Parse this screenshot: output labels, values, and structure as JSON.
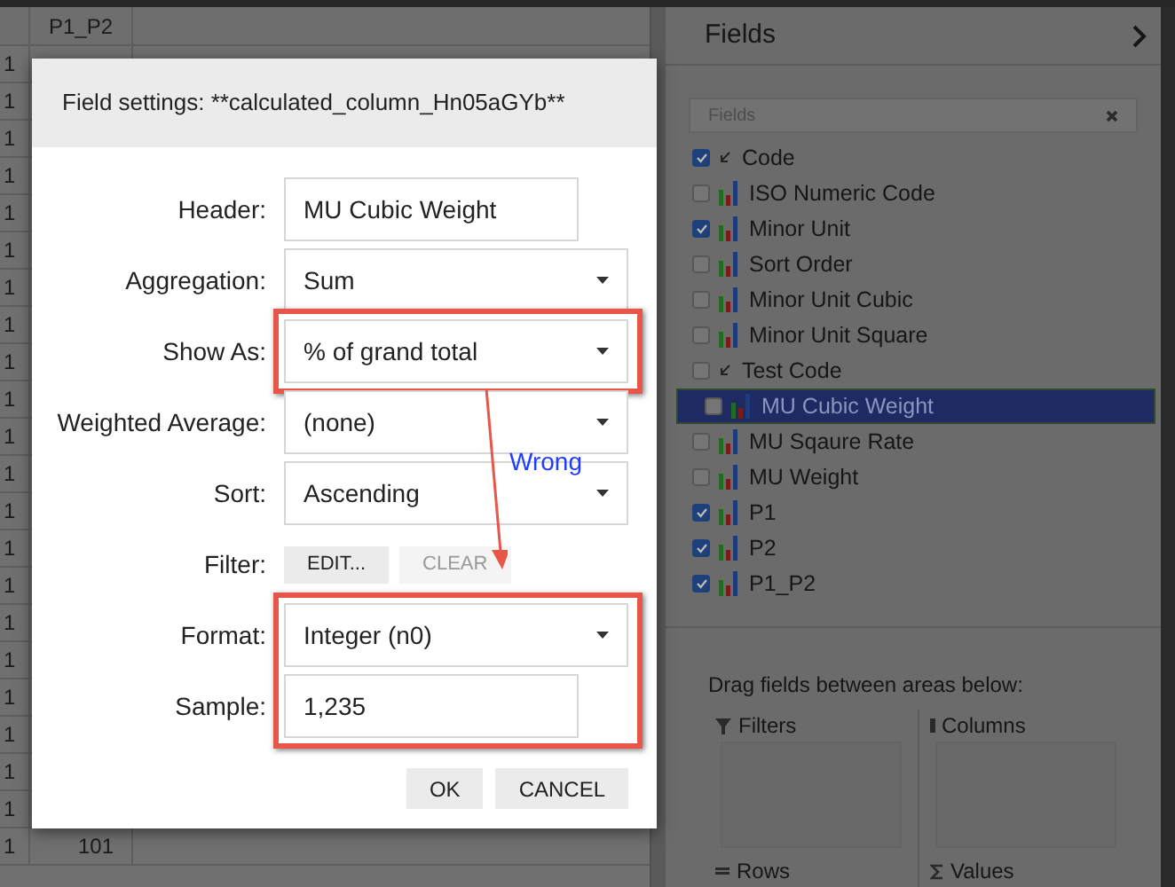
{
  "grid": {
    "header": "P1_P2",
    "rows": [
      {
        "column_1": "1"
      },
      {
        "column_1": "1"
      },
      {
        "column_1": "1"
      },
      {
        "column_1": "1"
      },
      {
        "column_1": "1"
      },
      {
        "column_1": "1"
      },
      {
        "column_1": "1"
      },
      {
        "column_1": "1"
      },
      {
        "column_1": "1"
      },
      {
        "column_1": "1"
      },
      {
        "column_1": "1"
      },
      {
        "column_1": "1"
      },
      {
        "column_1": "1"
      },
      {
        "column_1": "1"
      },
      {
        "column_1": "1"
      },
      {
        "column_1": "1"
      },
      {
        "column_1": "1"
      },
      {
        "column_1": "1"
      },
      {
        "column_1": "1"
      },
      {
        "column_1": "1"
      },
      {
        "column_1": "1"
      },
      {
        "column_1": "1",
        "p1_p2": "101"
      }
    ]
  },
  "dialog": {
    "title": "Field settings: **calculated_column_Hn05aGYb**",
    "rows": [
      {
        "kind": "input",
        "label": "Header:",
        "value": "MU Cubic Weight"
      },
      {
        "kind": "select",
        "label": "Aggregation:",
        "value": "Sum"
      },
      {
        "kind": "select",
        "label": "Show As:",
        "value": "% of grand total",
        "highlighted": true
      },
      {
        "kind": "select",
        "label": "Weighted Average:",
        "value": "(none)"
      },
      {
        "kind": "select",
        "label": "Sort:",
        "value": "Ascending"
      },
      {
        "kind": "buttons",
        "label": "Filter:",
        "buttons": [
          {
            "label": "EDIT...",
            "disabled": false
          },
          {
            "label": "CLEAR",
            "disabled": true
          }
        ]
      },
      {
        "kind": "select",
        "label": "Format:",
        "value": "Integer (n0)",
        "highlighted": true
      },
      {
        "kind": "input",
        "label": "Sample:",
        "value": "1,235",
        "highlighted": true
      }
    ],
    "buttons": [
      "OK",
      "CANCEL"
    ]
  },
  "annotation": {
    "text": "Wrong"
  },
  "fields_panel": {
    "title": "Fields",
    "search": {
      "placeholder": "Fields"
    },
    "items": [
      {
        "label": "Code",
        "kind": "dimension",
        "checked": true,
        "selected": false
      },
      {
        "label": "ISO Numeric Code",
        "kind": "measure",
        "checked": false,
        "selected": false
      },
      {
        "label": "Minor Unit",
        "kind": "measure",
        "checked": true,
        "selected": false
      },
      {
        "label": "Sort Order",
        "kind": "measure",
        "checked": false,
        "selected": false
      },
      {
        "label": "Minor Unit Cubic",
        "kind": "measure",
        "checked": false,
        "selected": false
      },
      {
        "label": "Minor Unit Square",
        "kind": "measure",
        "checked": false,
        "selected": false
      },
      {
        "label": "Test Code",
        "kind": "dimension",
        "checked": false,
        "selected": false
      },
      {
        "label": "MU Cubic Weight",
        "kind": "measure",
        "checked": false,
        "selected": true
      },
      {
        "label": "MU Sqaure Rate",
        "kind": "measure",
        "checked": false,
        "selected": false
      },
      {
        "label": "MU Weight",
        "kind": "measure",
        "checked": false,
        "selected": false
      },
      {
        "label": "P1",
        "kind": "measure",
        "checked": true,
        "selected": false
      },
      {
        "label": "P2",
        "kind": "measure",
        "checked": true,
        "selected": false
      },
      {
        "label": "P1_P2",
        "kind": "measure",
        "checked": true,
        "selected": false
      }
    ],
    "hint": "Drag fields between areas below:",
    "areas": [
      {
        "label": "Filters",
        "kind": "filters"
      },
      {
        "label": "Columns",
        "kind": "columns"
      },
      {
        "label": "Rows",
        "kind": "rows"
      },
      {
        "label": "Values",
        "kind": "values"
      }
    ]
  }
}
